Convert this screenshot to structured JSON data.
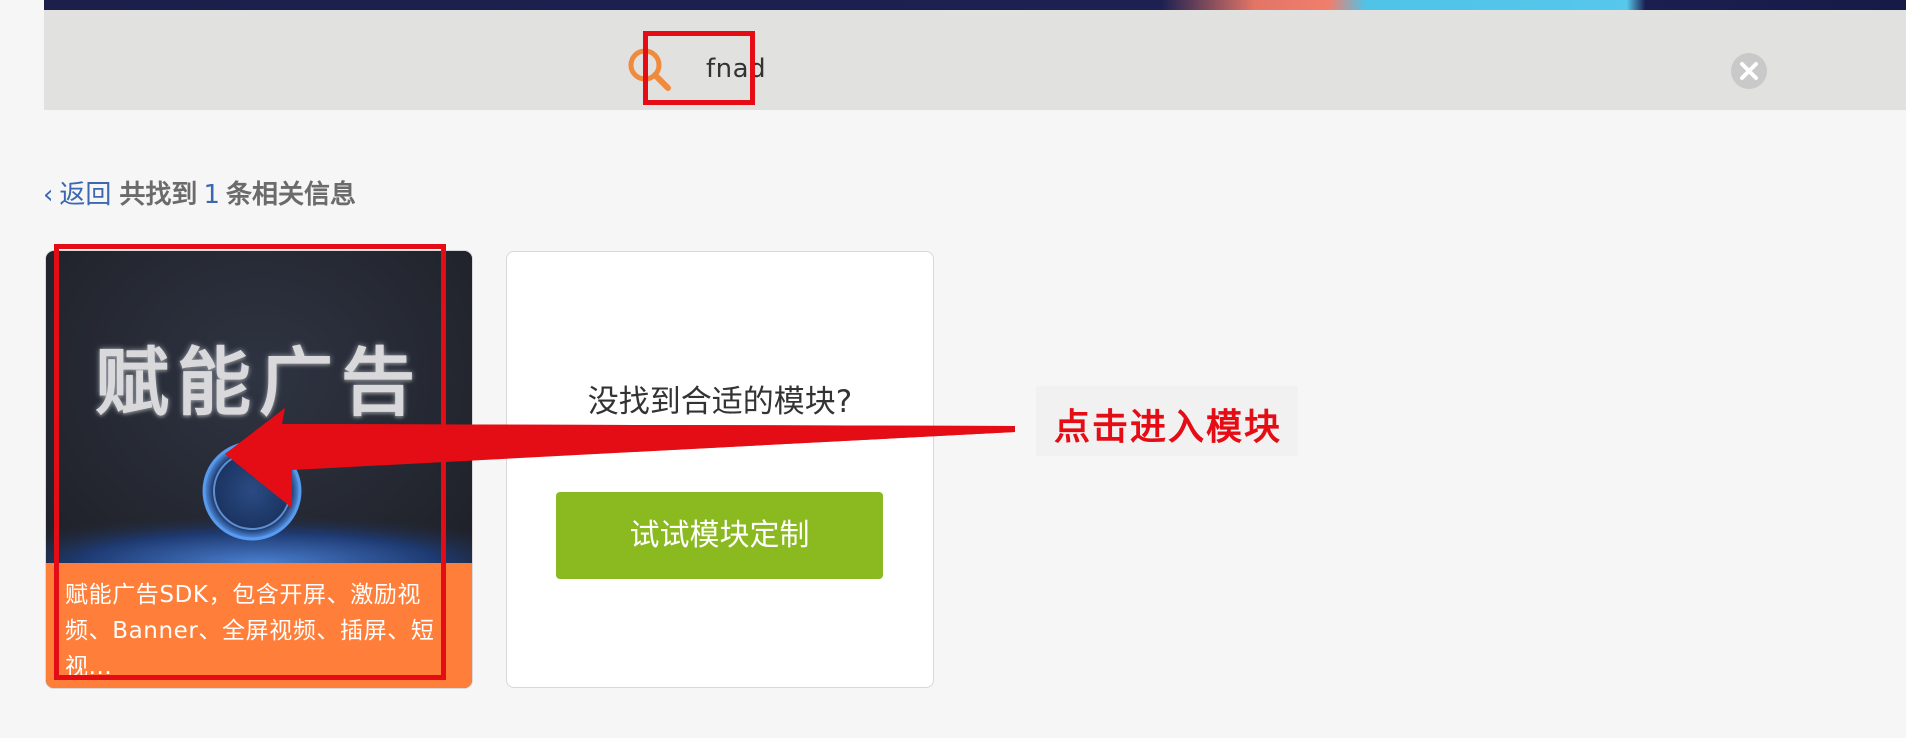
{
  "search": {
    "query": "fnad"
  },
  "results": {
    "back_label": "返回",
    "summary_prefix": "共找到",
    "count": "1",
    "summary_suffix": "条相关信息"
  },
  "module_card": {
    "image_title": "赋能广告",
    "description": "赋能广告SDK，包含开屏、激励视频、Banner、全屏视频、插屏、短视..."
  },
  "custom_card": {
    "question": "没找到合适的模块?",
    "button_label": "试试模块定制"
  },
  "annotation": {
    "label": "点击进入模块"
  },
  "colors": {
    "highlight_red": "#e50d15",
    "card_orange": "#ff7f3a",
    "button_green": "#8ab920",
    "link_blue": "#3c68b2",
    "search_icon_orange": "#f08a3c"
  }
}
